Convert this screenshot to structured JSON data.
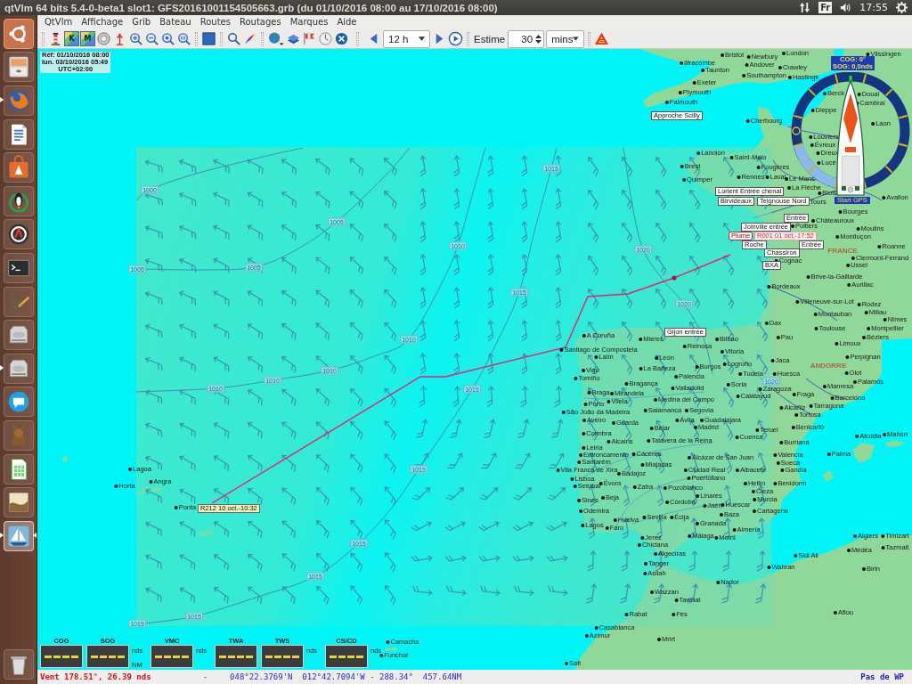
{
  "top_panel": {
    "title": "qtVlm 64 bits 5.4-0-beta1 slot1: GFS20161001154505663.grb (du 01/10/2016 08:00 au 17/10/2016 08:00)",
    "keyboard": "Fr",
    "clock": "17:55"
  },
  "launcher": {
    "items": [
      {
        "running": false,
        "focused": false
      },
      {
        "running": false,
        "focused": false
      },
      {
        "running": true,
        "focused": false
      },
      {
        "running": false,
        "focused": false
      },
      {
        "running": false,
        "focused": false
      },
      {
        "running": false,
        "focused": false
      },
      {
        "running": false,
        "focused": false
      },
      {
        "running": false,
        "focused": false
      },
      {
        "running": false,
        "focused": false
      },
      {
        "running": false,
        "focused": false
      },
      {
        "running": true,
        "focused": false
      },
      {
        "running": false,
        "focused": false
      },
      {
        "running": false,
        "focused": false
      },
      {
        "running": false,
        "focused": false
      },
      {
        "running": false,
        "focused": false
      },
      {
        "running": true,
        "focused": true
      },
      {
        "running": false,
        "focused": false
      }
    ]
  },
  "menu": [
    "QtVlm",
    "Affichage",
    "Grib",
    "Bateau",
    "Routes",
    "Routages",
    "Marques",
    "Aide"
  ],
  "toolbar": {
    "chart_buttons": [
      "K",
      "M"
    ],
    "period": "12 h",
    "estimate_label": "Estime",
    "estimate_value": "30",
    "estimate_unit": "mins"
  },
  "map": {
    "info": [
      "Réf: 01/10/2016 08:00",
      "lun. 03/10/2016 05:49",
      "UTC+02:00"
    ],
    "isobar_labels": [
      "1000",
      "1005",
      "1005",
      "1005",
      "1010",
      "1010",
      "1010",
      "1010",
      "1010",
      "1015",
      "1015",
      "1015",
      "1015",
      "1015",
      "1015",
      "1015",
      "1015",
      "1020",
      "1020",
      "1020"
    ],
    "places": [
      {
        "name": "Bristol",
        "kind": "city"
      },
      {
        "name": "Newbury",
        "kind": "city"
      },
      {
        "name": "London",
        "kind": "city"
      },
      {
        "name": "Vlissingen",
        "kind": "city"
      },
      {
        "name": "Ilfracombe",
        "kind": "city"
      },
      {
        "name": "Andover",
        "kind": "city"
      },
      {
        "name": "Taunton",
        "kind": "city"
      },
      {
        "name": "Crawley",
        "kind": "city"
      },
      {
        "name": "Southampton",
        "kind": "city"
      },
      {
        "name": "Hastings",
        "kind": "city"
      },
      {
        "name": "Exeter",
        "kind": "city"
      },
      {
        "name": "Plymouth",
        "kind": "city"
      },
      {
        "name": "Berck",
        "kind": "city"
      },
      {
        "name": "Douai",
        "kind": "city"
      },
      {
        "name": "Falmouth",
        "kind": "city"
      },
      {
        "name": "Cambrai",
        "kind": "city"
      },
      {
        "name": "Dieppe",
        "kind": "city"
      },
      {
        "name": "Cherbourg",
        "kind": "city"
      },
      {
        "name": "Laon",
        "kind": "city"
      },
      {
        "name": "Louviers",
        "kind": "city"
      },
      {
        "name": "Évreux",
        "kind": "city"
      },
      {
        "name": "Lannion",
        "kind": "city"
      },
      {
        "name": "Saint-Malo",
        "kind": "city"
      },
      {
        "name": "Dreux",
        "kind": "city"
      },
      {
        "name": "Brest",
        "kind": "city"
      },
      {
        "name": "Fougères",
        "kind": "city"
      },
      {
        "name": "Lucé",
        "kind": "city"
      },
      {
        "name": "Quimper",
        "kind": "city"
      },
      {
        "name": "Rennes",
        "kind": "city"
      },
      {
        "name": "Laval",
        "kind": "city"
      },
      {
        "name": "Le Mans",
        "kind": "city"
      },
      {
        "name": "La Flèche",
        "kind": "city"
      },
      {
        "name": "Blois",
        "kind": "city"
      },
      {
        "name": "Tours",
        "kind": "city"
      },
      {
        "name": "Avallon",
        "kind": "city"
      },
      {
        "name": "Bourges",
        "kind": "city"
      },
      {
        "name": "Châteauroux",
        "kind": "city"
      },
      {
        "name": "Poitiers",
        "kind": "city"
      },
      {
        "name": "Moulins",
        "kind": "city"
      },
      {
        "name": "Montluçon",
        "kind": "city"
      },
      {
        "name": "FRANCE",
        "kind": "country"
      },
      {
        "name": "Roanne",
        "kind": "city"
      },
      {
        "name": "Cognac",
        "kind": "city"
      },
      {
        "name": "Clermont-Ferrand",
        "kind": "city"
      },
      {
        "name": "Ussel",
        "kind": "city"
      },
      {
        "name": "Brive-la-Gaillarde",
        "kind": "city"
      },
      {
        "name": "Bordeaux",
        "kind": "city"
      },
      {
        "name": "Aurillac",
        "kind": "city"
      },
      {
        "name": "Villeneuve-sur-Lot",
        "kind": "city"
      },
      {
        "name": "Rodez",
        "kind": "city"
      },
      {
        "name": "Montauban",
        "kind": "city"
      },
      {
        "name": "Millau",
        "kind": "city"
      },
      {
        "name": "Dax",
        "kind": "city"
      },
      {
        "name": "Nîmes",
        "kind": "city"
      },
      {
        "name": "Toulouse",
        "kind": "city"
      },
      {
        "name": "Montpellier",
        "kind": "city"
      },
      {
        "name": "A Coruña",
        "kind": "city"
      },
      {
        "name": "Mieres",
        "kind": "city"
      },
      {
        "name": "Bilbao",
        "kind": "city"
      },
      {
        "name": "Pau",
        "kind": "city"
      },
      {
        "name": "Béziers",
        "kind": "city"
      },
      {
        "name": "Santiago de Compostela",
        "kind": "city"
      },
      {
        "name": "Reinosa",
        "kind": "city"
      },
      {
        "name": "Limoux",
        "kind": "city"
      },
      {
        "name": "Vitoria",
        "kind": "city"
      },
      {
        "name": "Lalín",
        "kind": "city"
      },
      {
        "name": "León",
        "kind": "city"
      },
      {
        "name": "Perpignan",
        "kind": "city"
      },
      {
        "name": "Vigo",
        "kind": "city"
      },
      {
        "name": "La Bañeza",
        "kind": "city"
      },
      {
        "name": "Burgos",
        "kind": "city"
      },
      {
        "name": "Logroño",
        "kind": "city"
      },
      {
        "name": "Jaca",
        "kind": "city"
      },
      {
        "name": "ANDORRE",
        "kind": "country"
      },
      {
        "name": "Tomiño",
        "kind": "city"
      },
      {
        "name": "Palencia",
        "kind": "city"
      },
      {
        "name": "Tudela",
        "kind": "city"
      },
      {
        "name": "Huesca",
        "kind": "city"
      },
      {
        "name": "Olot",
        "kind": "city"
      },
      {
        "name": "Bragança",
        "kind": "city"
      },
      {
        "name": "Valladolid",
        "kind": "city"
      },
      {
        "name": "Soria",
        "kind": "city"
      },
      {
        "name": "Zaragoza",
        "kind": "city"
      },
      {
        "name": "Manresa",
        "kind": "city"
      },
      {
        "name": "Palamós",
        "kind": "city"
      },
      {
        "name": "Braga",
        "kind": "city"
      },
      {
        "name": "Mirandela",
        "kind": "city"
      },
      {
        "name": "Porto",
        "kind": "city"
      },
      {
        "name": "Vilela",
        "kind": "city"
      },
      {
        "name": "Medina del Campo",
        "kind": "city"
      },
      {
        "name": "Calatayud",
        "kind": "city"
      },
      {
        "name": "Fraga",
        "kind": "city"
      },
      {
        "name": "Barcelona",
        "kind": "city"
      },
      {
        "name": "São João da Madeira",
        "kind": "city"
      },
      {
        "name": "Salamanca",
        "kind": "city"
      },
      {
        "name": "Segovia",
        "kind": "city"
      },
      {
        "name": "Alcañiz",
        "kind": "city"
      },
      {
        "name": "Tarragona",
        "kind": "city"
      },
      {
        "name": "Tortosa",
        "kind": "city"
      },
      {
        "name": "Aveiro",
        "kind": "city"
      },
      {
        "name": "Guarda",
        "kind": "city"
      },
      {
        "name": "Ávila",
        "kind": "city"
      },
      {
        "name": "Guadalajara",
        "kind": "city"
      },
      {
        "name": "Béjar",
        "kind": "city"
      },
      {
        "name": "Madrid",
        "kind": "city"
      },
      {
        "name": "Coimbra",
        "kind": "city"
      },
      {
        "name": "Teruel",
        "kind": "city"
      },
      {
        "name": "Benicarló",
        "kind": "city"
      },
      {
        "name": "Alcains",
        "kind": "city"
      },
      {
        "name": "Talavera de la Reina",
        "kind": "city"
      },
      {
        "name": "Cuenca",
        "kind": "city"
      },
      {
        "name": "Alcúdia",
        "kind": "city"
      },
      {
        "name": "Mahón",
        "kind": "city"
      },
      {
        "name": "Burriana",
        "kind": "city"
      },
      {
        "name": "Leiria",
        "kind": "city"
      },
      {
        "name": "Entroncamento",
        "kind": "city"
      },
      {
        "name": "Cáceres",
        "kind": "city"
      },
      {
        "name": "Alcázar de San Juan",
        "kind": "city"
      },
      {
        "name": "Valencia",
        "kind": "city"
      },
      {
        "name": "Palma",
        "kind": "city"
      },
      {
        "name": "Lagoa",
        "kind": "city"
      },
      {
        "name": "Santarém",
        "kind": "city"
      },
      {
        "name": "Miajadas",
        "kind": "city"
      },
      {
        "name": "Sueca",
        "kind": "city"
      },
      {
        "name": "Vila Franca de Xira",
        "kind": "city"
      },
      {
        "name": "Badajoz",
        "kind": "city"
      },
      {
        "name": "Ciudad Real",
        "kind": "city"
      },
      {
        "name": "Albacete",
        "kind": "city"
      },
      {
        "name": "Gandia",
        "kind": "city"
      },
      {
        "name": "Horta",
        "kind": "city"
      },
      {
        "name": "Angra",
        "kind": "city"
      },
      {
        "name": "Lisboa",
        "kind": "city"
      },
      {
        "name": "Setúbal",
        "kind": "city"
      },
      {
        "name": "Évora",
        "kind": "city"
      },
      {
        "name": "Zafra",
        "kind": "city"
      },
      {
        "name": "Pozoblanco",
        "kind": "city"
      },
      {
        "name": "Puertollano",
        "kind": "city"
      },
      {
        "name": "Hellín",
        "kind": "city"
      },
      {
        "name": "Benidorm",
        "kind": "city"
      },
      {
        "name": "Cieza",
        "kind": "city"
      },
      {
        "name": "Sines",
        "kind": "city"
      },
      {
        "name": "Beja",
        "kind": "city"
      },
      {
        "name": "Ponta",
        "kind": "city"
      },
      {
        "name": "Córdoba",
        "kind": "city"
      },
      {
        "name": "Linares",
        "kind": "city"
      },
      {
        "name": "Jaén",
        "kind": "city"
      },
      {
        "name": "Huéscar",
        "kind": "city"
      },
      {
        "name": "Murcia",
        "kind": "city"
      },
      {
        "name": "Odemira",
        "kind": "city"
      },
      {
        "name": "Huelva",
        "kind": "city"
      },
      {
        "name": "Sevilla",
        "kind": "city"
      },
      {
        "name": "Écija",
        "kind": "city"
      },
      {
        "name": "Baza",
        "kind": "city"
      },
      {
        "name": "Cartagena",
        "kind": "city"
      },
      {
        "name": "Lagos",
        "kind": "city"
      },
      {
        "name": "Faro",
        "kind": "city"
      },
      {
        "name": "Granada",
        "kind": "city"
      },
      {
        "name": "Jerez",
        "kind": "city"
      },
      {
        "name": "Málaga",
        "kind": "city"
      },
      {
        "name": "Motril",
        "kind": "city"
      },
      {
        "name": "Almería",
        "kind": "city"
      },
      {
        "name": "Algiers",
        "kind": "city"
      },
      {
        "name": "Timizart",
        "kind": "city"
      },
      {
        "name": "Chiclana",
        "kind": "city"
      },
      {
        "name": "Médéa",
        "kind": "city"
      },
      {
        "name": "Tazmalt",
        "kind": "city"
      },
      {
        "name": "Algeciras",
        "kind": "city"
      },
      {
        "name": "Sidi Ali",
        "kind": "city"
      },
      {
        "name": "Tanger",
        "kind": "city"
      },
      {
        "name": "Wahran",
        "kind": "city"
      },
      {
        "name": "Birin",
        "kind": "city"
      },
      {
        "name": "Asilah",
        "kind": "city"
      },
      {
        "name": "Nador",
        "kind": "city"
      },
      {
        "name": "Wazzan",
        "kind": "city"
      },
      {
        "name": "Tawnat",
        "kind": "city"
      },
      {
        "name": "Rabat",
        "kind": "city"
      },
      {
        "name": "Fès",
        "kind": "city"
      },
      {
        "name": "Aflou",
        "kind": "city"
      },
      {
        "name": "Casablanca",
        "kind": "city"
      },
      {
        "name": "Azimur",
        "kind": "city"
      },
      {
        "name": "Camacha",
        "kind": "city"
      },
      {
        "name": "Mrirt",
        "kind": "city"
      },
      {
        "name": "Funchal",
        "kind": "city"
      },
      {
        "name": "Safi",
        "kind": "city"
      }
    ],
    "marks": [
      {
        "name": "Approche Scilly",
        "kind": "waypoint"
      },
      {
        "name": "Lorient Entrée chenal",
        "kind": "waypoint"
      },
      {
        "name": "Birvideaux",
        "kind": "waypoint"
      },
      {
        "name": "Teignouse Nord",
        "kind": "waypoint"
      },
      {
        "name": "Entrée",
        "kind": "waypoint"
      },
      {
        "name": "Joinville entrée",
        "kind": "waypoint"
      },
      {
        "name": "Plume",
        "kind": "boat"
      },
      {
        "name": "R001 01 oct.-17:52",
        "kind": "route-point"
      },
      {
        "name": "Roche",
        "kind": "waypoint"
      },
      {
        "name": "Entrée",
        "kind": "waypoint"
      },
      {
        "name": "Chassiron",
        "kind": "waypoint"
      },
      {
        "name": "BXA",
        "kind": "waypoint"
      },
      {
        "name": "Gijon entrée",
        "kind": "waypoint"
      },
      {
        "name": "R212 10 oct.-10:32",
        "kind": "route-end"
      }
    ],
    "compass": {
      "cog": "COG: 0°",
      "sog": "SOG: 0,0nds",
      "gps_button": "Start GPS"
    }
  },
  "instruments": [
    {
      "label": "COG"
    },
    {
      "label": "SOG",
      "units": [
        "nds",
        "NM"
      ]
    },
    {
      "label": "VMC",
      "units": [
        "nds"
      ]
    },
    {
      "label": "TWA"
    },
    {
      "label": "TWS",
      "units": [
        "nds"
      ]
    },
    {
      "label": "CS/CD",
      "units": [
        "nds"
      ]
    }
  ],
  "status_bar": {
    "wind": "Vent 178.51°, 26.39 nds",
    "separator": "-",
    "position": "048°22.3769'N  012°42.7094'W - 288.34°  457.64NM",
    "waypoint": "Pas de WP"
  }
}
